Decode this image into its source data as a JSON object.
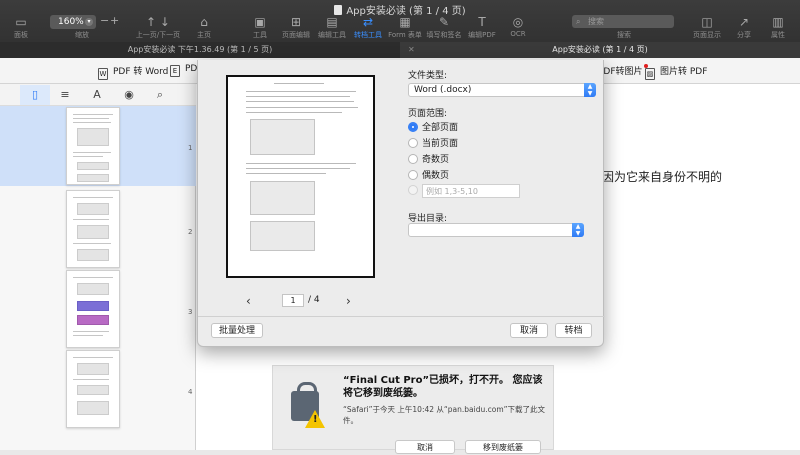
{
  "window": {
    "title": "App安装必读 (第 1 / 4 页)"
  },
  "toolbar": {
    "sidebar_label": "面板",
    "zoom_value": "160%",
    "zoom_label": "缩放",
    "zoom_minus": "−",
    "zoom_plus": "+",
    "nav_label": "上一页/下一页",
    "home_label": "主页",
    "tools": [
      "工具",
      "页面编辑",
      "编辑工具",
      "转档工具",
      "Form 表单",
      "填写和签名",
      "编辑PDF",
      "OCR"
    ],
    "active_tool": "转档工具",
    "search_placeholder": "搜索",
    "search_label": "搜索",
    "page_display_label": "页面显示",
    "share_label": "分享",
    "properties_label": "属性"
  },
  "tabs": [
    {
      "label": "App安装必读 下午1.36.49 (第 1 / 5 页)"
    },
    {
      "label": "App安装必读 (第 1 / 4 页)"
    }
  ],
  "convert_bar": {
    "word": "PDF 转 Word",
    "excel_partial": "PDF",
    "to_image": "PDF转图片",
    "image_to_pdf": "图片转 PDF"
  },
  "sidebar": {
    "page_numbers": [
      "1",
      "2",
      "3",
      "4"
    ]
  },
  "document": {
    "visible_text": "因为它来自身份不明的",
    "alert": {
      "title": "“Final Cut Pro”已损坏，打不开。 您应该将它移到废纸篓。",
      "body": "“Safari”于今天 上午10:42 从“pan.baidu.com”下载了此文件。",
      "cancel": "取消",
      "trash": "移到废纸篓"
    }
  },
  "dialog": {
    "file_type_label": "文件类型:",
    "file_type_value": "Word (.docx)",
    "page_range_label": "页面范围:",
    "options": [
      "全部页面",
      "当前页面",
      "奇数页",
      "偶数页"
    ],
    "selected_option": "全部页面",
    "range_placeholder": "例如 1,3-5,10",
    "export_dir_label": "导出目录:",
    "current_page": "1",
    "total_pages": "/ 4",
    "batch_button": "批量处理",
    "cancel_button": "取消",
    "convert_button": "转档"
  },
  "colors": {
    "accent": "#2f7bf5",
    "toolbar_bg": "#353535"
  },
  "icons": [
    "sidebar-toggle-icon",
    "zoom-chevron-icon",
    "arrow-up-icon",
    "arrow-down-icon",
    "home-icon",
    "toolbox-icon",
    "grid-icon",
    "edit-icon",
    "convert-icon",
    "form-icon",
    "sign-icon",
    "pdf-edit-icon",
    "ocr-icon",
    "search-icon",
    "page-display-icon",
    "share-icon",
    "properties-icon",
    "word-icon",
    "excel-icon",
    "image-icon",
    "thumbnails-icon",
    "outline-icon",
    "annotation-icon",
    "camera-icon",
    "sidebar-search-icon",
    "chevron-left-icon",
    "chevron-right-icon",
    "lock-icon",
    "warning-icon"
  ]
}
